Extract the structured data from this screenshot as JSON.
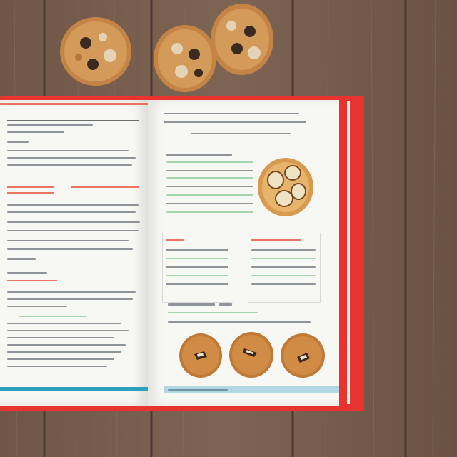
{
  "scene": {
    "description_elements": [
      "wooden-table",
      "open-cookbook",
      "cookies"
    ],
    "colors": {
      "wood": "#7a6150",
      "book_cover": "#e8332f",
      "page": "#f7f7f4",
      "accent_cyan": "#2f9fc0",
      "accent_red": "#e84a30",
      "cookie": "#c98a4a"
    }
  },
  "book": {
    "left_page": {
      "heading_1": "",
      "heading_2": "",
      "section_title": ""
    },
    "right_page": {
      "section_title": "",
      "box_1_title": "",
      "box_2_title": ""
    }
  }
}
